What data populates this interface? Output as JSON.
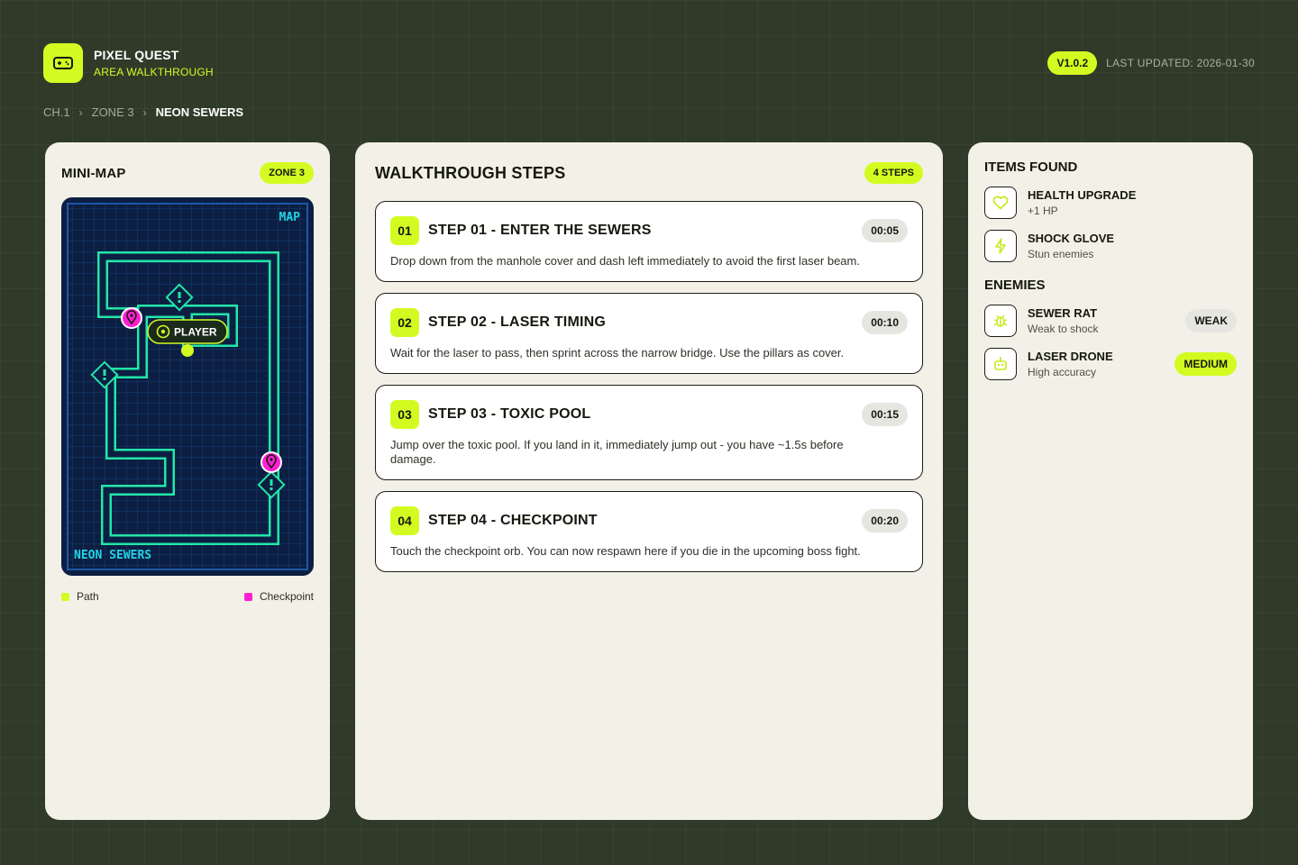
{
  "app": {
    "title": "PIXEL QUEST",
    "subtitle": "AREA WALKTHROUGH",
    "logo_icon": "gamepad-icon"
  },
  "meta": {
    "version": "V1.0.2",
    "last_updated": "LAST UPDATED: 2026-01-30"
  },
  "breadcrumb": {
    "items": [
      "CH.1",
      "ZONE 3",
      "NEON SEWERS"
    ],
    "separator": "›"
  },
  "minimap": {
    "title": "MINI-MAP",
    "zone_badge": "ZONE 3",
    "map_label": "MAP",
    "area_name": "NEON SEWERS",
    "player_label": "PLAYER",
    "legend": [
      {
        "label": "Path",
        "color": "#d4fb21"
      },
      {
        "label": "Checkpoint",
        "color": "#ff1fd2"
      }
    ]
  },
  "steps": {
    "title": "WALKTHROUGH STEPS",
    "count_badge": "4 STEPS",
    "items": [
      {
        "num": "01",
        "title": "STEP 01 - ENTER THE SEWERS",
        "time": "00:05",
        "desc": "Drop down from the manhole cover and dash left immediately to avoid the first laser beam."
      },
      {
        "num": "02",
        "title": "STEP 02 - LASER TIMING",
        "time": "00:10",
        "desc": "Wait for the laser to pass, then sprint across the narrow bridge. Use the pillars as cover."
      },
      {
        "num": "03",
        "title": "STEP 03 - TOXIC POOL",
        "time": "00:15",
        "desc": "Jump over the toxic pool. If you land in it, immediately jump out - you have ~1.5s before damage."
      },
      {
        "num": "04",
        "title": "STEP 04 - CHECKPOINT",
        "time": "00:20",
        "desc": "Touch the checkpoint orb. You can now respawn here if you die in the upcoming boss fight."
      }
    ]
  },
  "items_found": {
    "title": "ITEMS FOUND",
    "items": [
      {
        "name": "HEALTH UPGRADE",
        "sub": "+1 HP",
        "icon": "heart-icon"
      },
      {
        "name": "SHOCK GLOVE",
        "sub": "Stun enemies",
        "icon": "lightning-icon"
      }
    ]
  },
  "enemies": {
    "title": "ENEMIES",
    "items": [
      {
        "name": "SEWER RAT",
        "sub": "Weak to shock",
        "tag": "WEAK",
        "icon": "bug-icon"
      },
      {
        "name": "LASER DRONE",
        "sub": "High accuracy",
        "tag": "MEDIUM",
        "icon": "robot-icon"
      }
    ]
  },
  "colors": {
    "accent": "#d4fb21",
    "background": "#2f3a29",
    "panel": "#f3f1e7",
    "map_path": "#22e6a8",
    "checkpoint": "#ff1fd2"
  }
}
